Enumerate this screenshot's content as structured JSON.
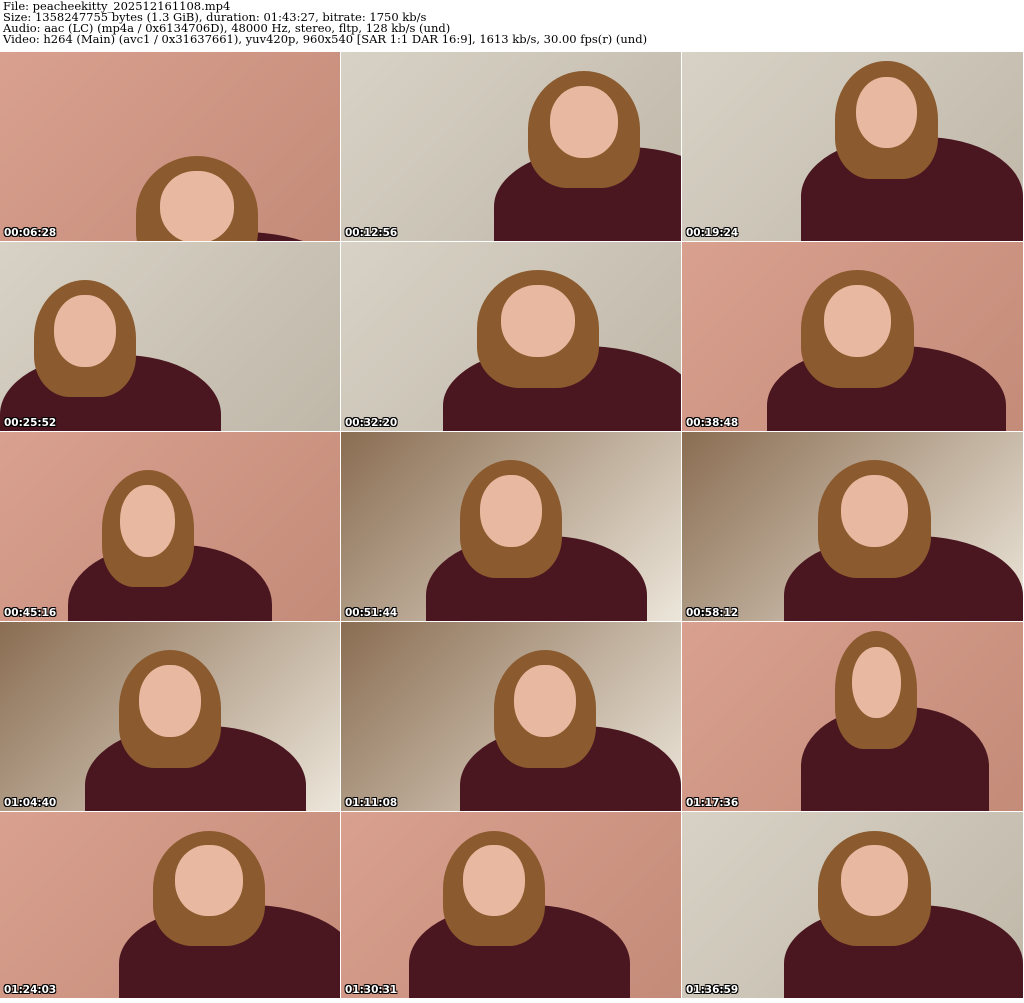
{
  "header": {
    "file_line": "File: peacheekitty_202512161108.mp4",
    "size_line": "Size: 1358247755 bytes (1.3 GiB), duration: 01:43:27, bitrate: 1750 kb/s",
    "audio_line": "Audio: aac (LC) (mp4a / 0x6134706D), 48000 Hz, stereo, fltp, 128 kb/s (und)",
    "video_line": "Video: h264 (Main) (avc1 / 0x31637661), yuv420p, 960x540 [SAR 1:1 DAR 16:9], 1613 kb/s, 30.00 fps(r) (und)"
  },
  "thumbnails": [
    {
      "timestamp": "00:06:28",
      "scene": "pink-room"
    },
    {
      "timestamp": "00:12:56",
      "scene": "stairs"
    },
    {
      "timestamp": "00:19:24",
      "scene": "stairs"
    },
    {
      "timestamp": "00:25:52",
      "scene": "stairs"
    },
    {
      "timestamp": "00:32:20",
      "scene": "stairs"
    },
    {
      "timestamp": "00:38:48",
      "scene": "pink-room"
    },
    {
      "timestamp": "00:45:16",
      "scene": "pink-room"
    },
    {
      "timestamp": "00:51:44",
      "scene": "chair"
    },
    {
      "timestamp": "00:58:12",
      "scene": "chair"
    },
    {
      "timestamp": "01:04:40",
      "scene": "chair"
    },
    {
      "timestamp": "01:11:08",
      "scene": "chair"
    },
    {
      "timestamp": "01:17:36",
      "scene": "pink-room"
    },
    {
      "timestamp": "01:24:03",
      "scene": "pink-room"
    },
    {
      "timestamp": "01:30:31",
      "scene": "pink-room"
    },
    {
      "timestamp": "01:36:59",
      "scene": "stairs"
    }
  ],
  "colors": {
    "pink-room": [
      "#d9a08f",
      "#c48b79"
    ],
    "stairs": [
      "#d8d2c6",
      "#bfb7a8"
    ],
    "chair": [
      "#8a6d52",
      "#ece6da"
    ],
    "hair": "#8b5a2e",
    "sweater": "#4a1620",
    "skin": "#e8b8a0"
  }
}
